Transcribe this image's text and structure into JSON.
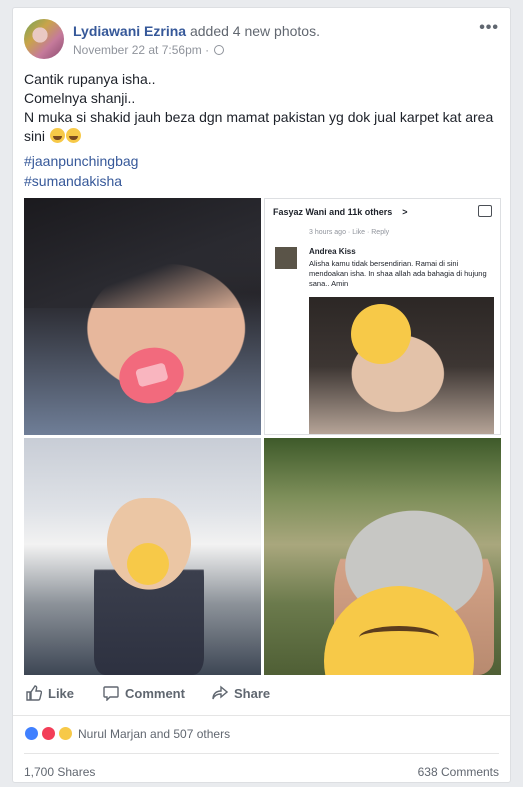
{
  "post": {
    "author": "Lydiawani Ezrina",
    "action": " added 4 new photos.",
    "timestamp": "November 22 at 7:56pm",
    "more": "•••",
    "text_lines": [
      "Cantik rupanya isha..",
      "Comelnya shanji..",
      "N muka si shakid jauh beza dgn mamat pakistan yg dok jual karpet kat area sini"
    ],
    "hashtags": [
      "#jaanpunchingbag",
      "#sumandakisha"
    ]
  },
  "photo2": {
    "header_names": "Fasyaz Wani and 11k others",
    "caret": ">",
    "time": "3 hours ago · Like · Reply",
    "commenter": "Andrea Kiss",
    "comment": "Alisha kamu tidak bersendirian. Ramai di sini mendoakan isha. In shaa allah ada bahagia di hujung sana.. Amin"
  },
  "actions": {
    "like": "Like",
    "comment": "Comment",
    "share": "Share"
  },
  "reactions": {
    "text": "Nurul Marjan and 507 others"
  },
  "footer": {
    "shares": "1,700 Shares",
    "comments": "638 Comments"
  },
  "icons": [
    "globe-icon",
    "like-icon",
    "comment-icon",
    "share-icon",
    "like-reaction-icon",
    "love-reaction-icon",
    "haha-reaction-icon",
    "laugh-emoji-icon",
    "crying-emoji-icon"
  ],
  "colors": {
    "link": "#365899",
    "like_blue": "#4080ff",
    "love_red": "#f33e58",
    "haha_yellow": "#f7c948"
  }
}
